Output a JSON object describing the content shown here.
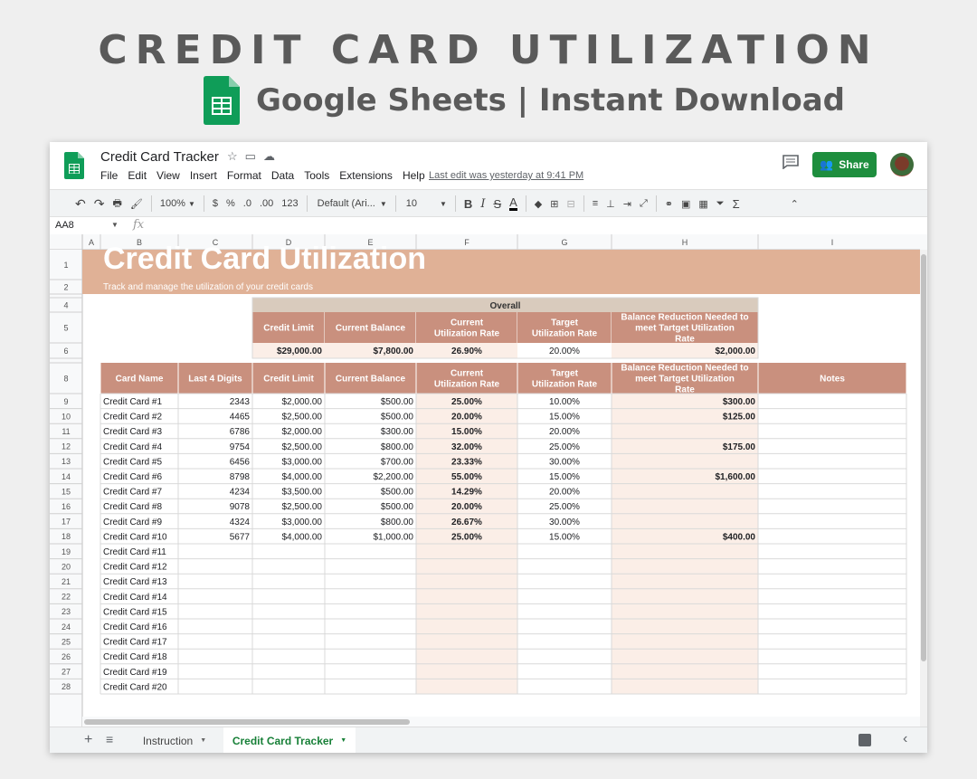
{
  "hero": {
    "title": "CREDIT CARD UTILIZATION",
    "subtitle": "Google Sheets | Instant Download"
  },
  "app": {
    "doc_title": "Credit Card Tracker",
    "menu": [
      "File",
      "Edit",
      "View",
      "Insert",
      "Format",
      "Data",
      "Tools",
      "Extensions",
      "Help"
    ],
    "last_edit": "Last edit was yesterday at 9:41 PM",
    "share_label": "Share",
    "name_box": "AA8",
    "fx": "fx"
  },
  "toolbar": {
    "zoom": "100%",
    "currency": "$",
    "percent": "%",
    "dec_less": ".0",
    "dec_more": ".00",
    "format_more": "123",
    "font": "Default (Ari...",
    "font_size": "10"
  },
  "sheet": {
    "columns": [
      "A",
      "B",
      "C",
      "D",
      "E",
      "F",
      "G",
      "H",
      "I"
    ],
    "title": "Credit Card Utilization",
    "subtitle": "Track and manage the utilization of your credit cards",
    "overall": {
      "label": "Overall",
      "headers": [
        "Credit Limit",
        "Current Balance",
        "Current Utilization Rate",
        "Target Utilization Rate",
        "Balance Reduction Needed to meet Tartget Utilization Rate"
      ],
      "values": [
        "$29,000.00",
        "$7,800.00",
        "26.90%",
        "20.00%",
        "$2,000.00"
      ]
    },
    "table_headers": [
      "Card Name",
      "Last 4 Digits",
      "Credit Limit",
      "Current Balance",
      "Current Utilization Rate",
      "Target Utilization Rate",
      "Balance Reduction Needed to meet Tartget Utilization Rate",
      "Notes"
    ],
    "rows": [
      [
        "Credit Card #1",
        "2343",
        "$2,000.00",
        "$500.00",
        "25.00%",
        "10.00%",
        "$300.00",
        ""
      ],
      [
        "Credit Card #2",
        "4465",
        "$2,500.00",
        "$500.00",
        "20.00%",
        "15.00%",
        "$125.00",
        ""
      ],
      [
        "Credit Card #3",
        "6786",
        "$2,000.00",
        "$300.00",
        "15.00%",
        "20.00%",
        "",
        ""
      ],
      [
        "Credit Card #4",
        "9754",
        "$2,500.00",
        "$800.00",
        "32.00%",
        "25.00%",
        "$175.00",
        ""
      ],
      [
        "Credit Card #5",
        "6456",
        "$3,000.00",
        "$700.00",
        "23.33%",
        "30.00%",
        "",
        ""
      ],
      [
        "Credit Card #6",
        "8798",
        "$4,000.00",
        "$2,200.00",
        "55.00%",
        "15.00%",
        "$1,600.00",
        ""
      ],
      [
        "Credit Card #7",
        "4234",
        "$3,500.00",
        "$500.00",
        "14.29%",
        "20.00%",
        "",
        ""
      ],
      [
        "Credit Card #8",
        "9078",
        "$2,500.00",
        "$500.00",
        "20.00%",
        "25.00%",
        "",
        ""
      ],
      [
        "Credit Card #9",
        "4324",
        "$3,000.00",
        "$800.00",
        "26.67%",
        "30.00%",
        "",
        ""
      ],
      [
        "Credit Card #10",
        "5677",
        "$4,000.00",
        "$1,000.00",
        "25.00%",
        "15.00%",
        "$400.00",
        ""
      ],
      [
        "Credit Card #11",
        "",
        "",
        "",
        "",
        "",
        "",
        ""
      ],
      [
        "Credit Card #12",
        "",
        "",
        "",
        "",
        "",
        "",
        ""
      ],
      [
        "Credit Card #13",
        "",
        "",
        "",
        "",
        "",
        "",
        ""
      ],
      [
        "Credit Card #14",
        "",
        "",
        "",
        "",
        "",
        "",
        ""
      ],
      [
        "Credit Card #15",
        "",
        "",
        "",
        "",
        "",
        "",
        ""
      ],
      [
        "Credit Card #16",
        "",
        "",
        "",
        "",
        "",
        "",
        ""
      ],
      [
        "Credit Card #17",
        "",
        "",
        "",
        "",
        "",
        "",
        ""
      ],
      [
        "Credit Card #18",
        "",
        "",
        "",
        "",
        "",
        "",
        ""
      ],
      [
        "Credit Card #19",
        "",
        "",
        "",
        "",
        "",
        "",
        ""
      ],
      [
        "Credit Card #20",
        "",
        "",
        "",
        "",
        "",
        "",
        ""
      ]
    ]
  },
  "tabs": [
    "Instruction",
    "Credit Card Tracker"
  ],
  "colors": {
    "title_band": "#e0b196",
    "header_fill": "#c9907e",
    "overall_fill": "#d9cbbd",
    "light_fill": "#fbeee7",
    "share_green": "#1e8e3e"
  }
}
